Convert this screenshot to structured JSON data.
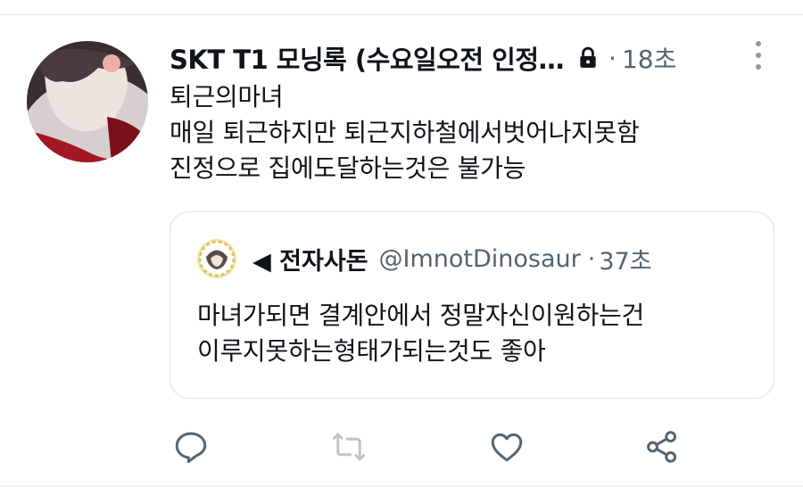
{
  "tweet": {
    "author_name": "SKT T1 모닝록 (수요일오전 인정…",
    "time_separator": "·",
    "time": "18초",
    "lines": [
      "퇴근의마녀",
      "매일 퇴근하지만 퇴근지하철에서벗어나지못함",
      "진정으로 집에도달하는것은 불가능"
    ]
  },
  "quote": {
    "author_name": "◀ 전자사돈",
    "handle": "@ImnotDinosaur",
    "time_separator": "·",
    "time": "37초",
    "lines": [
      "마녀가되면 결계안에서 정말자신이원하는건",
      "이루지못하는형태가되는것도 좋아"
    ]
  },
  "icons": {
    "lock": "lock-icon",
    "more": "more-vertical-icon",
    "reply": "reply-icon",
    "retweet": "retweet-icon",
    "like": "like-icon",
    "share": "share-icon"
  },
  "colors": {
    "text": "#0f1419",
    "secondary": "#536471",
    "icon": "#536471",
    "retweet_disabled": "#bcc5cc",
    "border": "#d9e1e8"
  }
}
